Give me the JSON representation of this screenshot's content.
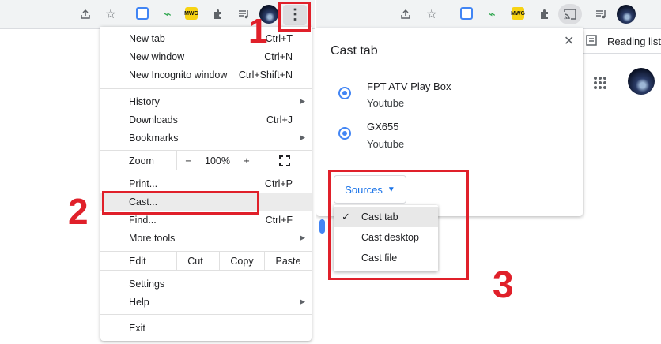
{
  "left": {
    "step_number": "1",
    "step_number_2": "2",
    "ext_badge_text": "MWG",
    "menu": {
      "items": [
        {
          "label": "New tab",
          "shortcut": "Ctrl+T"
        },
        {
          "label": "New window",
          "shortcut": "Ctrl+N"
        },
        {
          "label": "New Incognito window",
          "shortcut": "Ctrl+Shift+N"
        },
        {
          "label": "History",
          "shortcut": ""
        },
        {
          "label": "Downloads",
          "shortcut": "Ctrl+J"
        },
        {
          "label": "Bookmarks",
          "shortcut": ""
        },
        {
          "label": "Print...",
          "shortcut": "Ctrl+P"
        },
        {
          "label": "Cast...",
          "shortcut": ""
        },
        {
          "label": "Find...",
          "shortcut": "Ctrl+F"
        },
        {
          "label": "More tools",
          "shortcut": ""
        },
        {
          "label": "Settings",
          "shortcut": ""
        },
        {
          "label": "Help",
          "shortcut": ""
        },
        {
          "label": "Exit",
          "shortcut": ""
        }
      ],
      "zoom": {
        "label": "Zoom",
        "minus": "−",
        "value": "100%",
        "plus": "+"
      },
      "edit": {
        "label": "Edit",
        "cut": "Cut",
        "copy": "Copy",
        "paste": "Paste"
      }
    }
  },
  "right": {
    "step_number": "3",
    "ext_badge_text": "MWG",
    "reading_list": "Reading list",
    "dialog": {
      "title": "Cast tab",
      "close": "✕",
      "devices": [
        {
          "name": "FPT ATV Play Box",
          "source": "Youtube"
        },
        {
          "name": "GX655",
          "source": "Youtube"
        }
      ],
      "sources_label": "Sources",
      "sources_options": [
        "Cast tab",
        "Cast desktop",
        "Cast file"
      ],
      "selected_source": "Cast tab"
    }
  },
  "colors": {
    "accent": "#1a73e8",
    "highlight_red": "#e0202a",
    "toolbar": "#f1f3f4"
  }
}
